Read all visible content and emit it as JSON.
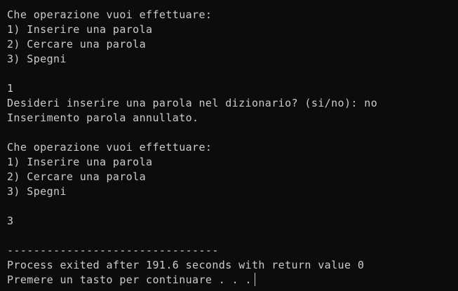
{
  "console": {
    "lines": [
      "Che operazione vuoi effettuare:",
      "1) Inserire una parola",
      "2) Cercare una parola",
      "3) Spegni",
      "",
      "1",
      "Desideri inserire una parola nel dizionario? (si/no): no",
      "Inserimento parola annullato.",
      "",
      "Che operazione vuoi effettuare:",
      "1) Inserire una parola",
      "2) Cercare una parola",
      "3) Spegni",
      "",
      "3",
      "",
      "--------------------------------",
      "Process exited after 191.6 seconds with return value 0",
      "Premere un tasto per continuare . . ."
    ],
    "colors": {
      "background": "#0c0c0c",
      "text": "#cccccc"
    }
  }
}
